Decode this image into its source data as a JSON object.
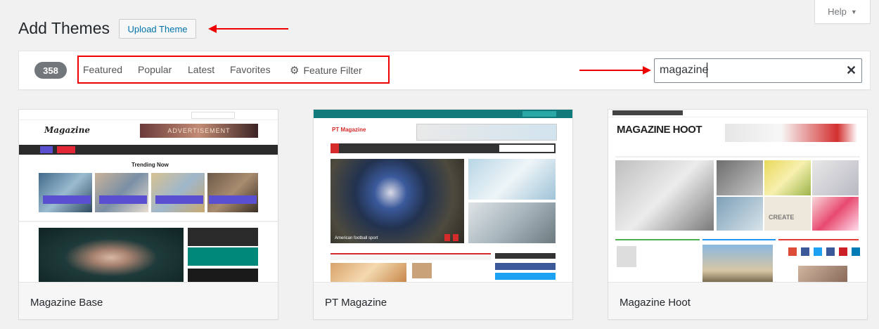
{
  "help": {
    "label": "Help",
    "icon": "triangle-down-icon"
  },
  "header": {
    "title": "Add Themes",
    "upload_label": "Upload Theme"
  },
  "filter": {
    "count": "358",
    "tabs": [
      "Featured",
      "Popular",
      "Latest",
      "Favorites"
    ],
    "feature_filter": "Feature Filter",
    "feature_icon": "gear-icon"
  },
  "search": {
    "value": "magazine",
    "clear_icon": "close-icon"
  },
  "annotation_color": "#e00000",
  "themes": [
    {
      "name": "Magazine Base",
      "screenshot": {
        "site_title": "Magazine",
        "banner": "ADVERTISEMENT",
        "section": "Trending Now"
      }
    },
    {
      "name": "PT Magazine",
      "screenshot": {
        "site_title": "PT Magazine",
        "caption": "American football sport"
      }
    },
    {
      "name": "Magazine Hoot",
      "screenshot": {
        "site_title": "MAGAZINE HOOT",
        "caption": "CREATE"
      }
    }
  ]
}
